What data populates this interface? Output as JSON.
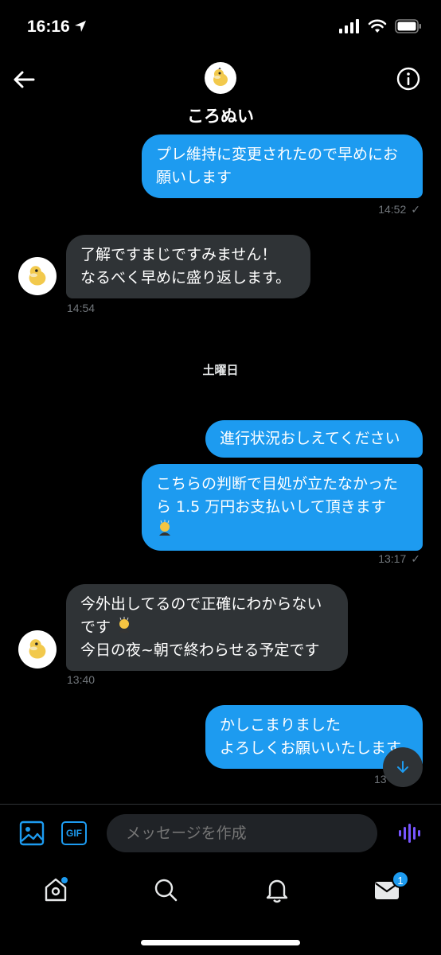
{
  "status_bar": {
    "time": "16:16"
  },
  "header": {
    "name": "ころぬい"
  },
  "messages": {
    "m1": {
      "text": "プレ維持に変更されたので早めにお願いします",
      "time": "14:52"
    },
    "m2": {
      "line1": "了解ですまじですみません！",
      "line2": "なるべく早めに盛り返します。",
      "time": "14:54"
    },
    "day_separator": "土曜日",
    "m3": {
      "text": "進行状況おしえてください"
    },
    "m4": {
      "line1": "こちらの判断で目処が立たなかったら 1.5 万円お支払いして頂きます",
      "time": "13:17"
    },
    "m5": {
      "line1": "今外出してるので正確にわからないです",
      "line2": "今日の夜~朝で終わらせる予定です",
      "time": "13:40"
    },
    "m6": {
      "line1": "かしこまりました",
      "line2": "よろしくお願いいたします",
      "time": "13"
    }
  },
  "composer": {
    "gif_label": "GIF",
    "placeholder": "メッセージを作成"
  },
  "tabbar": {
    "messages_badge": "1"
  },
  "colors": {
    "accent": "#1d9bf0",
    "incoming": "#2f3336",
    "background": "#000000",
    "voice": "#7856ff"
  }
}
